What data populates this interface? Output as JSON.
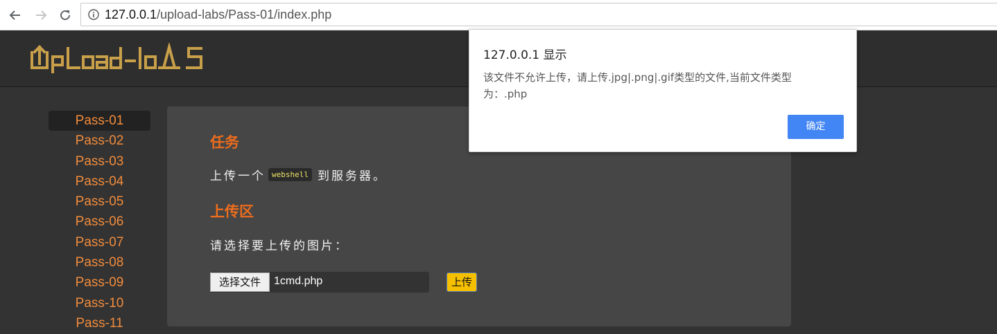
{
  "browser": {
    "url_host": "127.0.0.1",
    "url_path": "/upload-labs/Pass-01/index.php"
  },
  "header": {
    "logo_text": "Upload-labs",
    "logo_color": "#c9a04a"
  },
  "sidebar": {
    "active_index": 0,
    "items": [
      {
        "label": "Pass-01"
      },
      {
        "label": "Pass-02"
      },
      {
        "label": "Pass-03"
      },
      {
        "label": "Pass-04"
      },
      {
        "label": "Pass-05"
      },
      {
        "label": "Pass-06"
      },
      {
        "label": "Pass-07"
      },
      {
        "label": "Pass-08"
      },
      {
        "label": "Pass-09"
      },
      {
        "label": "Pass-10"
      },
      {
        "label": "Pass-11"
      }
    ]
  },
  "main": {
    "task_heading": "任务",
    "task_prefix": "上传一个",
    "task_code": "webshell",
    "task_suffix": "到服务器。",
    "upload_heading": "上传区",
    "upload_prompt": "请选择要上传的图片：",
    "choose_file_label": "选择文件",
    "file_name": "1cmd.php",
    "upload_button_label": "上传"
  },
  "dialog": {
    "title": "127.0.0.1 显示",
    "message": "该文件不允许上传，请上传.jpg|.png|.gif类型的文件,当前文件类型为：.php",
    "ok_label": "确定"
  },
  "colors": {
    "page_background": "#333333",
    "accent_orange": "#ed6d1d",
    "sidebar_link": "#f28c3c",
    "upload_button": "#f5c000",
    "dialog_button": "#4285f4"
  }
}
